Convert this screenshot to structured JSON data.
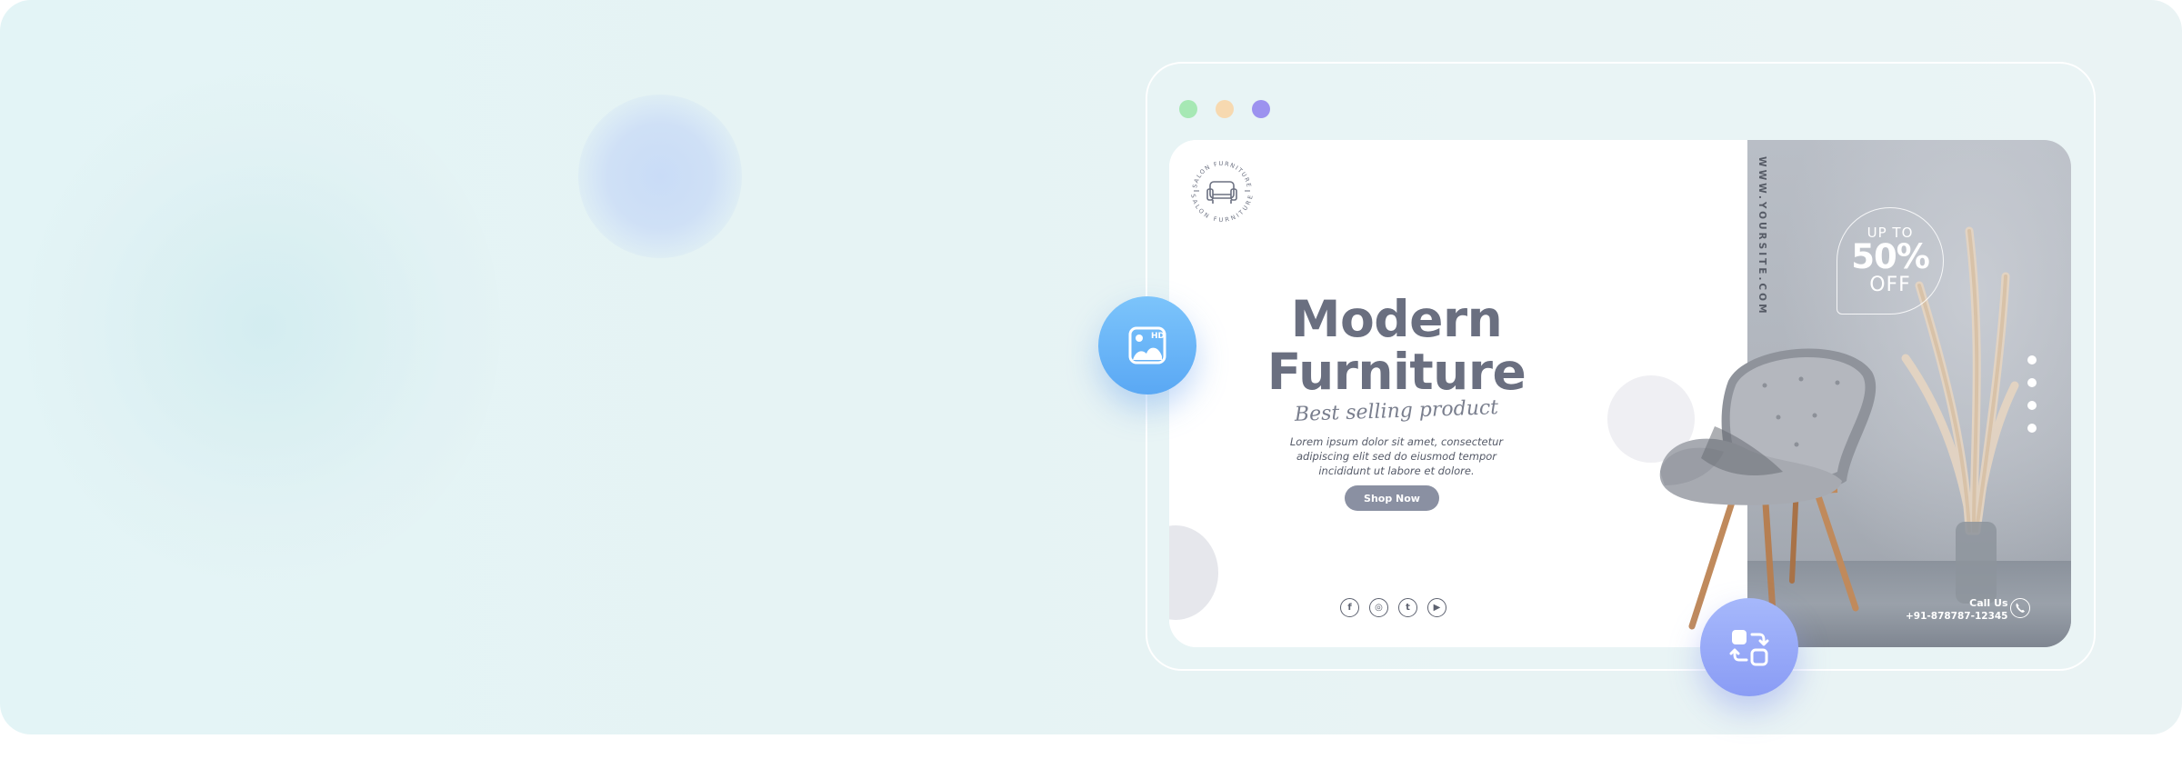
{
  "window": {
    "controls": [
      "green",
      "orange",
      "purple"
    ],
    "colors": {
      "green": "#a6e8b4",
      "orange": "#f7d9b0",
      "purple": "#9c92ef"
    }
  },
  "floating_buttons": {
    "hd_image": {
      "icon": "hd-image-icon",
      "badge": "HD",
      "color": "#5aa8f4"
    },
    "convert": {
      "icon": "convert-icon",
      "color": "#8a9cf5"
    }
  },
  "banner": {
    "logo": {
      "icon": "sofa-logo-icon",
      "text_top": "SALON FURNITURE",
      "text_bottom": "SALON FURNITURE"
    },
    "headline_line1": "Modern",
    "headline_line2": "Furniture",
    "tagline": "Best selling product",
    "description": "Lorem ipsum dolor sit amet, consectetur adipiscing elit sed do eiusmod tempor incididunt ut labore et dolore.",
    "cta_label": "Shop Now",
    "socials": [
      {
        "icon": "facebook-icon",
        "glyph": "f"
      },
      {
        "icon": "instagram-icon",
        "glyph": "◎"
      },
      {
        "icon": "twitter-icon",
        "glyph": "t"
      },
      {
        "icon": "youtube-icon",
        "glyph": "▶"
      }
    ],
    "website": "WWW.YOURSITE.COM",
    "offer": {
      "line1": "UP TO",
      "line2": "50%",
      "line3": "OFF"
    },
    "call_label": "Call Us",
    "phone": "+91-878787-12345",
    "accent_color": "#6a6f80"
  }
}
